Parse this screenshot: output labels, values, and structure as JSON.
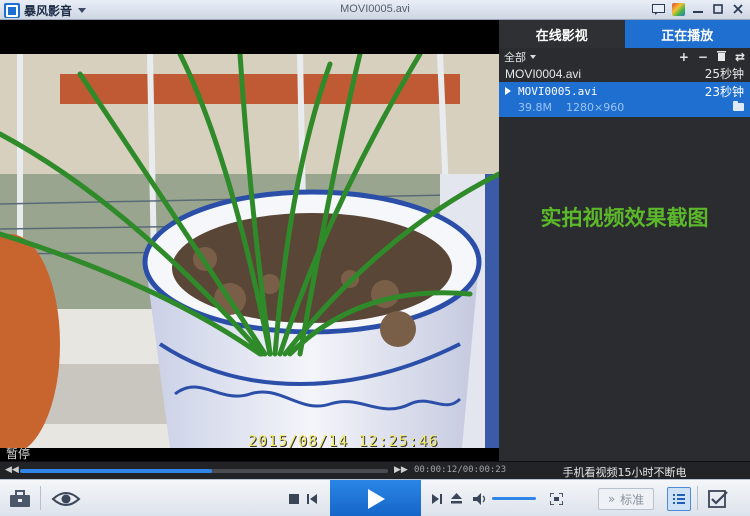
{
  "app": {
    "name": "暴风影音",
    "window_title": "MOVI0005.avi"
  },
  "video": {
    "timestamp": "2015/08/14 12:25:46",
    "status": "暂停"
  },
  "panel": {
    "tabs": [
      {
        "label": "在线影视",
        "active": false
      },
      {
        "label": "正在播放",
        "active": true
      }
    ],
    "filter_label": "全部",
    "actions": [
      "add-icon",
      "remove-icon",
      "delete-icon",
      "loop-icon"
    ],
    "items": [
      {
        "name": "MOVI0004.avi",
        "duration": "25秒钟",
        "active": false
      },
      {
        "name": "MOVI0005.avi",
        "duration": "23秒钟",
        "active": true,
        "size": "39.8M",
        "resolution": "1280×960"
      }
    ],
    "promo_text": "实拍视频效果截图",
    "promo_color": "#5bb82a"
  },
  "progress": {
    "fraction": 0.5217,
    "time_text": "00:00:12/00:00:23",
    "bottom_promo": "手机看视频15小时不断电"
  },
  "controls": {
    "std_label": "标准",
    "volume_fraction": 1.0
  },
  "colors": {
    "accent": "#1f6fd1",
    "progress": "#2f86e8"
  }
}
